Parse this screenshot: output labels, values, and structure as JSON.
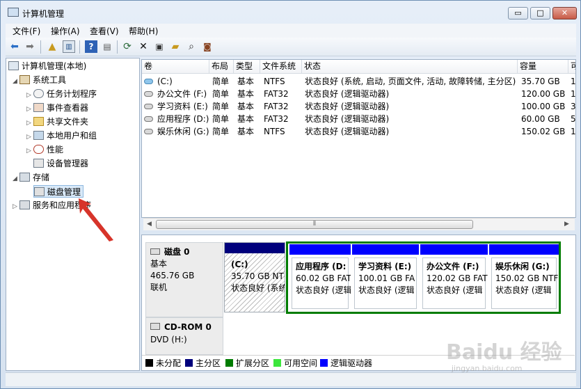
{
  "window": {
    "title": "计算机管理"
  },
  "caption_buttons": {
    "minimize": "▭",
    "maximize": "□",
    "close": "✕"
  },
  "menu": [
    "文件(F)",
    "操作(A)",
    "查看(V)",
    "帮助(H)"
  ],
  "tree": {
    "root": "计算机管理(本地)",
    "system_tools": "系统工具",
    "task_scheduler": "任务计划程序",
    "event_viewer": "事件查看器",
    "shared_folders": "共享文件夹",
    "local_users": "本地用户和组",
    "performance": "性能",
    "device_manager": "设备管理器",
    "storage": "存储",
    "disk_management": "磁盘管理",
    "services_apps": "服务和应用程序"
  },
  "volume_table": {
    "headers": [
      "卷",
      "布局",
      "类型",
      "文件系统",
      "状态",
      "容量",
      "可"
    ],
    "rows": [
      [
        "(C:)",
        "简单",
        "基本",
        "NTFS",
        "状态良好 (系统, 启动, 页面文件, 活动, 故障转储, 主分区)",
        "35.70 GB",
        "1"
      ],
      [
        "办公文件 (F:)",
        "简单",
        "基本",
        "FAT32",
        "状态良好 (逻辑驱动器)",
        "120.00 GB",
        "1"
      ],
      [
        "学习资料 (E:)",
        "简单",
        "基本",
        "FAT32",
        "状态良好 (逻辑驱动器)",
        "100.00 GB",
        "3"
      ],
      [
        "应用程序 (D:)",
        "简单",
        "基本",
        "FAT32",
        "状态良好 (逻辑驱动器)",
        "60.00 GB",
        "5"
      ],
      [
        "娱乐休闲 (G:)",
        "简单",
        "基本",
        "NTFS",
        "状态良好 (逻辑驱动器)",
        "150.02 GB",
        "1"
      ]
    ]
  },
  "disk0": {
    "name": "磁盘 0",
    "type": "基本",
    "size": "465.76 GB",
    "status": "联机",
    "partitions": [
      {
        "name": "(C:)",
        "size": "35.70 GB NTFS",
        "status": "状态良好 (系统"
      },
      {
        "name": "应用程序 (D:",
        "size": "60.02 GB FAT",
        "status": "状态良好 (逻辑"
      },
      {
        "name": "学习资料 (E:)",
        "size": "100.01 GB FA",
        "status": "状态良好 (逻辑"
      },
      {
        "name": "办公文件 (F:)",
        "size": "120.02 GB FAT",
        "status": "状态良好 (逻辑"
      },
      {
        "name": "娱乐休闲 (G:)",
        "size": "150.02 GB NTF",
        "status": "状态良好 (逻辑"
      }
    ]
  },
  "cdrom": {
    "name": "CD-ROM 0",
    "type": "DVD (H:)"
  },
  "legend": [
    "未分配",
    "主分区",
    "扩展分区",
    "可用空间",
    "逻辑驱动器"
  ],
  "colors": {
    "unallocated": "#000000",
    "primary": "#00007c",
    "extended": "#007c00",
    "free": "#3ce63c",
    "logical": "#0000ff"
  },
  "watermark": {
    "brand": "Baidu 经验",
    "site": "jingyan.baidu.com"
  }
}
